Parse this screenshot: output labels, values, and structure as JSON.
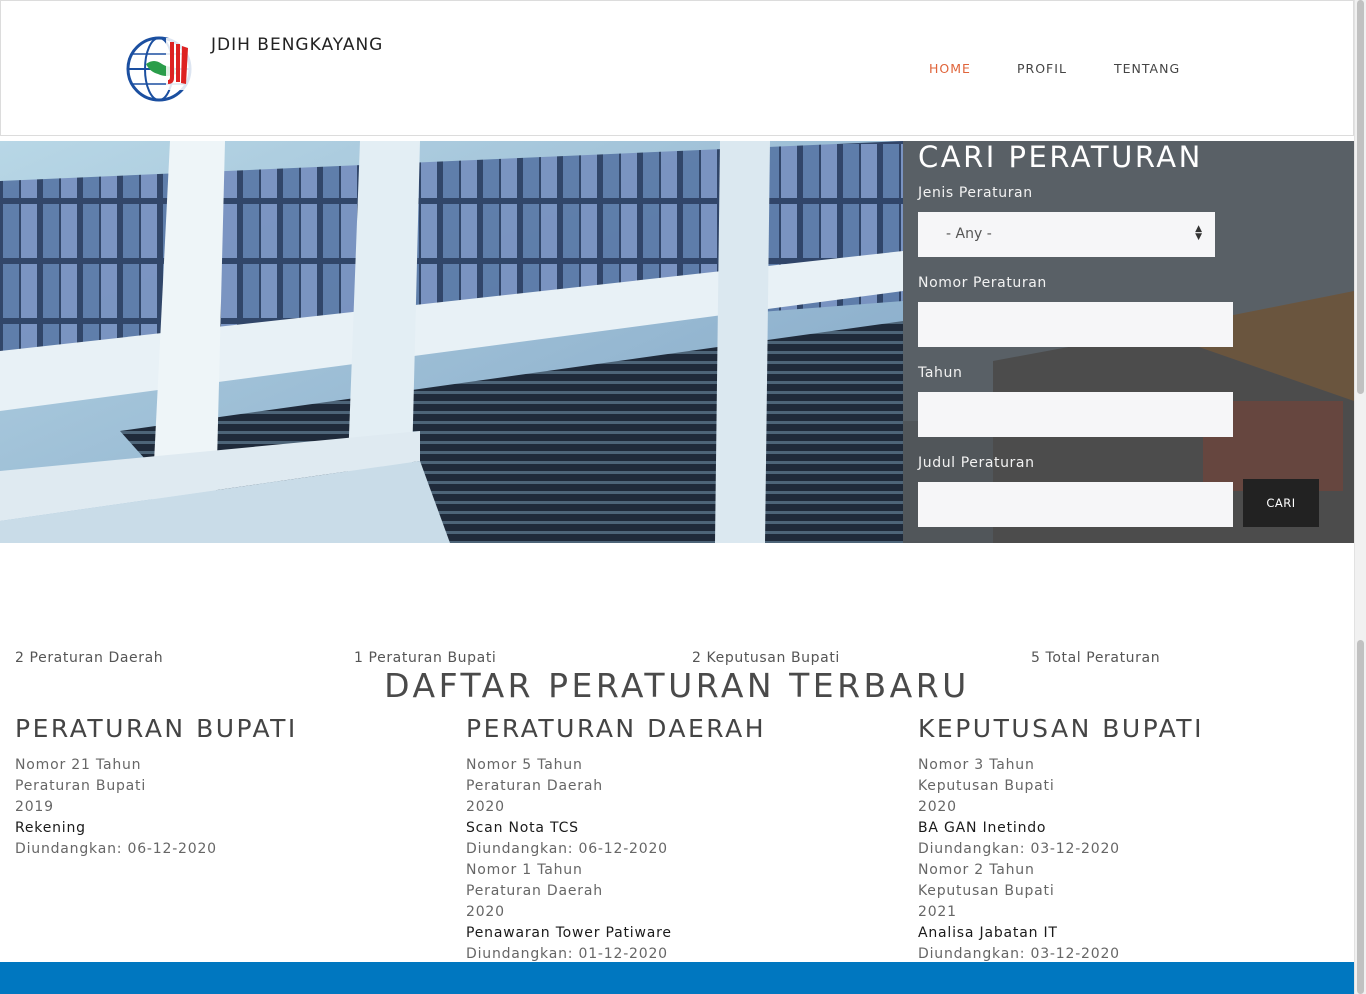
{
  "header": {
    "site_name": "JDIH BENGKAYANG",
    "nav": {
      "home": "HOME",
      "profil": "PROFIL",
      "tentang": "TENTANG"
    }
  },
  "search": {
    "title": "CARI PERATURAN",
    "jenis_label": "Jenis Peraturan",
    "jenis_value": "- Any -",
    "nomor_label": "Nomor Peraturan",
    "nomor_value": "",
    "tahun_label": "Tahun",
    "tahun_value": "",
    "judul_label": "Judul Peraturan",
    "judul_value": "",
    "button": "CARI"
  },
  "stats": [
    "2 Peraturan Daerah",
    "1 Peraturan Bupati",
    "2 Keputusan Bupati",
    "5 Total Peraturan"
  ],
  "list_title": "DAFTAR PERATURAN TERBARU",
  "columns": [
    {
      "title": "PERATURAN BUPATI",
      "entries": [
        {
          "nomor": "Nomor 21 Tahun",
          "jenis": "Peraturan Bupati",
          "tahun": "2019",
          "judul": "Rekening",
          "diundangkan": "Diundangkan: 06-12-2020"
        }
      ]
    },
    {
      "title": "PERATURAN DAERAH",
      "entries": [
        {
          "nomor": "Nomor 5 Tahun",
          "jenis": "Peraturan Daerah",
          "tahun": "2020",
          "judul": "Scan Nota TCS",
          "diundangkan": "Diundangkan: 06-12-2020"
        },
        {
          "nomor": "Nomor 1 Tahun",
          "jenis": "Peraturan Daerah",
          "tahun": "2020",
          "judul": "Penawaran Tower Patiware",
          "diundangkan": "Diundangkan: 01-12-2020"
        }
      ]
    },
    {
      "title": "KEPUTUSAN BUPATI",
      "entries": [
        {
          "nomor": "Nomor 3 Tahun",
          "jenis": "Keputusan Bupati",
          "tahun": "2020",
          "judul": "BA GAN Inetindo",
          "diundangkan": "Diundangkan: 03-12-2020"
        },
        {
          "nomor": "Nomor 2 Tahun",
          "jenis": "Keputusan Bupati",
          "tahun": "2021",
          "judul": "Analisa Jabatan IT",
          "diundangkan": "Diundangkan: 03-12-2020"
        }
      ]
    }
  ],
  "colors": {
    "accent": "#e0643a",
    "footer": "#0077c0",
    "button": "#222222"
  },
  "icons": {
    "logo": "jdih-globe-logo",
    "select": "up-down-arrows-icon"
  }
}
